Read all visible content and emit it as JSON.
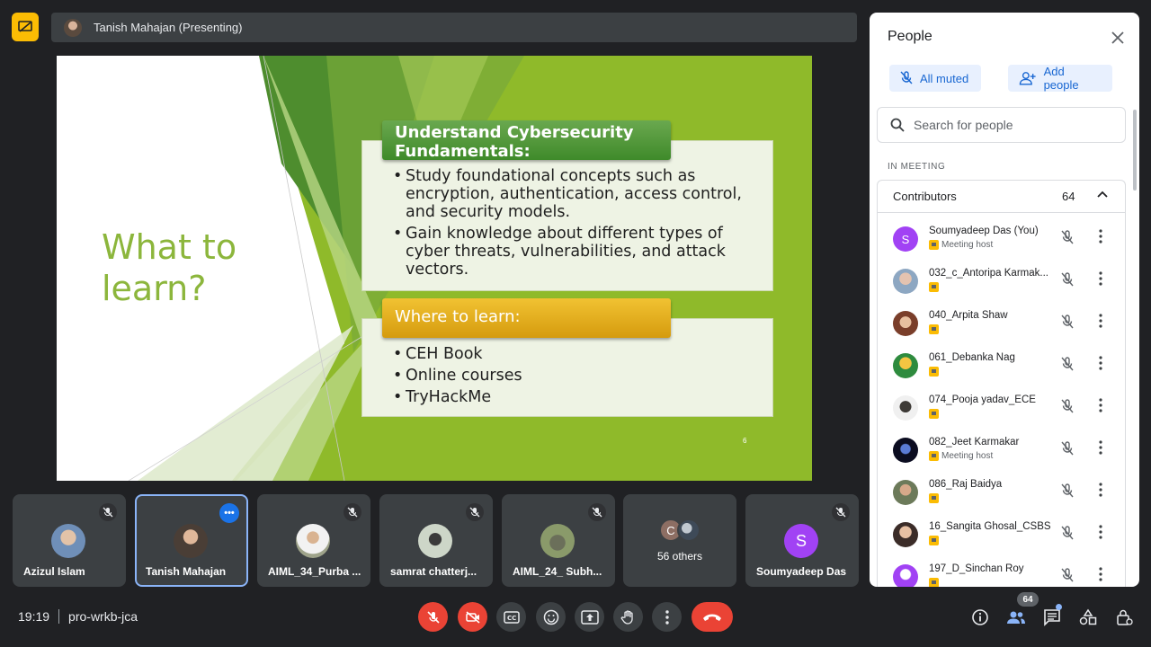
{
  "presenter": {
    "label": "Tanish Mahajan (Presenting)"
  },
  "slide": {
    "title": "What to learn?",
    "section1": {
      "header": "Understand Cybersecurity Fundamentals:",
      "bullets": [
        "Study foundational concepts such as encryption, authentication, access control, and security models.",
        "Gain knowledge about different types of cyber threats, vulnerabilities, and attack vectors."
      ]
    },
    "section2": {
      "header": "Where to learn:",
      "bullets": [
        "CEH Book",
        "Online courses",
        "TryHackMe"
      ]
    },
    "page_number": "6"
  },
  "tiles": [
    {
      "name": "Azizul Islam"
    },
    {
      "name": "Tanish Mahajan"
    },
    {
      "name": "AIML_34_Purba ..."
    },
    {
      "name": "samrat chatterj..."
    },
    {
      "name": "AIML_24_ Subh..."
    },
    {
      "name": "56 others",
      "initial": "C"
    },
    {
      "name": "Soumyadeep Das",
      "initial": "S"
    }
  ],
  "meeting": {
    "time": "19:19",
    "code": "pro-wrkb-jca",
    "participant_count": "64"
  },
  "people_panel": {
    "title": "People",
    "all_muted": "All muted",
    "add_people": "Add people",
    "search_placeholder": "Search for people",
    "section_label": "IN MEETING",
    "contributors_label": "Contributors",
    "contributors_count": "64",
    "participants": [
      {
        "name": "Soumyadeep Das (You)",
        "role": "Meeting host",
        "initial": "S"
      },
      {
        "name": "032_c_Antoripa Karmak...",
        "role": ""
      },
      {
        "name": "040_Arpita Shaw",
        "role": ""
      },
      {
        "name": "061_Debanka Nag",
        "role": ""
      },
      {
        "name": "074_Pooja yadav_ECE",
        "role": ""
      },
      {
        "name": "082_Jeet Karmakar",
        "role": "Meeting host"
      },
      {
        "name": "086_Raj Baidya",
        "role": ""
      },
      {
        "name": "16_Sangita Ghosal_CSBS",
        "role": ""
      },
      {
        "name": "197_D_Sinchan Roy",
        "role": ""
      }
    ]
  },
  "colors": {
    "accent_blue": "#1a73e8",
    "end_call_red": "#ea4335",
    "present_yellow": "#fbbc04",
    "slide_green": "#8cb63c"
  }
}
